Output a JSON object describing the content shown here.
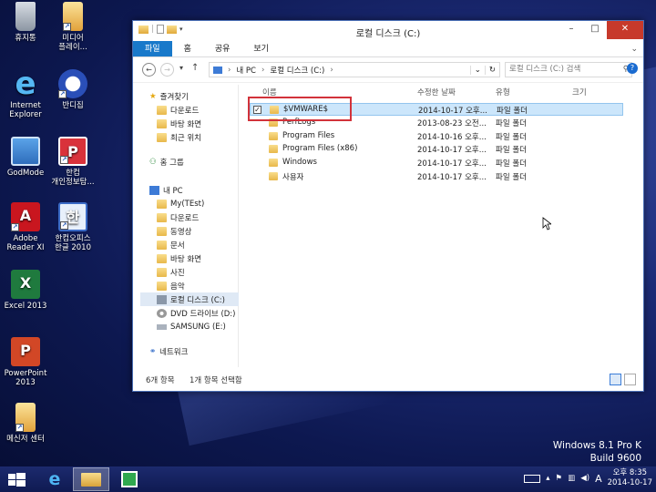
{
  "desktop": {
    "icons": [
      {
        "label": "휴지통",
        "icon": "recycle-bin-icon"
      },
      {
        "label": "미디어\n플레이...",
        "icon": "media-player-icon"
      },
      {
        "label": "Internet\nExplorer",
        "icon": "ie-icon"
      },
      {
        "label": "반디집",
        "icon": "bandizip-icon"
      },
      {
        "label": "GodMode",
        "icon": "godmode-icon"
      },
      {
        "label": "한컴\n개인정보탐...",
        "icon": "hancom-privacy-icon"
      },
      {
        "label": "Adobe\nReader XI",
        "icon": "adobe-reader-icon"
      },
      {
        "label": "한컴오피스\n한글 2010",
        "icon": "hangul-icon"
      },
      {
        "label": "Excel 2013",
        "icon": "excel-icon"
      },
      {
        "label": "PowerPoint\n2013",
        "icon": "powerpoint-icon"
      },
      {
        "label": "메신저 센터",
        "icon": "messenger-icon"
      }
    ],
    "watermark": {
      "line1": "Windows 8.1 Pro K",
      "line2": "Build 9600"
    }
  },
  "window": {
    "title": "로컬 디스크 (C:)",
    "ribbon_tabs": [
      "파일",
      "홈",
      "공유",
      "보기"
    ],
    "address": {
      "parts": [
        "내 PC",
        "로컬 디스크 (C:)"
      ]
    },
    "search_placeholder": "로컬 디스크 (C:) 검색",
    "nav": {
      "favorites": "즐겨찾기",
      "fav_items": [
        "다운로드",
        "바탕 화면",
        "최근 위치"
      ],
      "homegroup": "홈 그룹",
      "thispc": "내 PC",
      "pc_items": [
        "My(TEst)",
        "다운로드",
        "동영상",
        "문서",
        "바탕 화면",
        "사진",
        "음악",
        "로컬 디스크 (C:)",
        "DVD 드라이브 (D:)",
        "SAMSUNG (E:)"
      ],
      "network": "네트워크"
    },
    "columns": [
      "이름",
      "수정한 날짜",
      "유형",
      "크기"
    ],
    "files": [
      {
        "name": "$VMWARE$",
        "date": "2014-10-17 오후...",
        "type": "파일 폴더",
        "selected": true
      },
      {
        "name": "PerfLogs",
        "date": "2013-08-23 오전...",
        "type": "파일 폴더",
        "selected": false
      },
      {
        "name": "Program Files",
        "date": "2014-10-16 오후...",
        "type": "파일 폴더",
        "selected": false
      },
      {
        "name": "Program Files (x86)",
        "date": "2014-10-17 오후...",
        "type": "파일 폴더",
        "selected": false
      },
      {
        "name": "Windows",
        "date": "2014-10-17 오후...",
        "type": "파일 폴더",
        "selected": false
      },
      {
        "name": "사용자",
        "date": "2014-10-17 오후...",
        "type": "파일 폴더",
        "selected": false
      }
    ],
    "status": {
      "count": "6개 항목",
      "selected": "1개 항목 선택함"
    }
  },
  "taskbar": {
    "clock_time": "오후 8:35",
    "clock_date": "2014-10-17",
    "ime": "A"
  }
}
